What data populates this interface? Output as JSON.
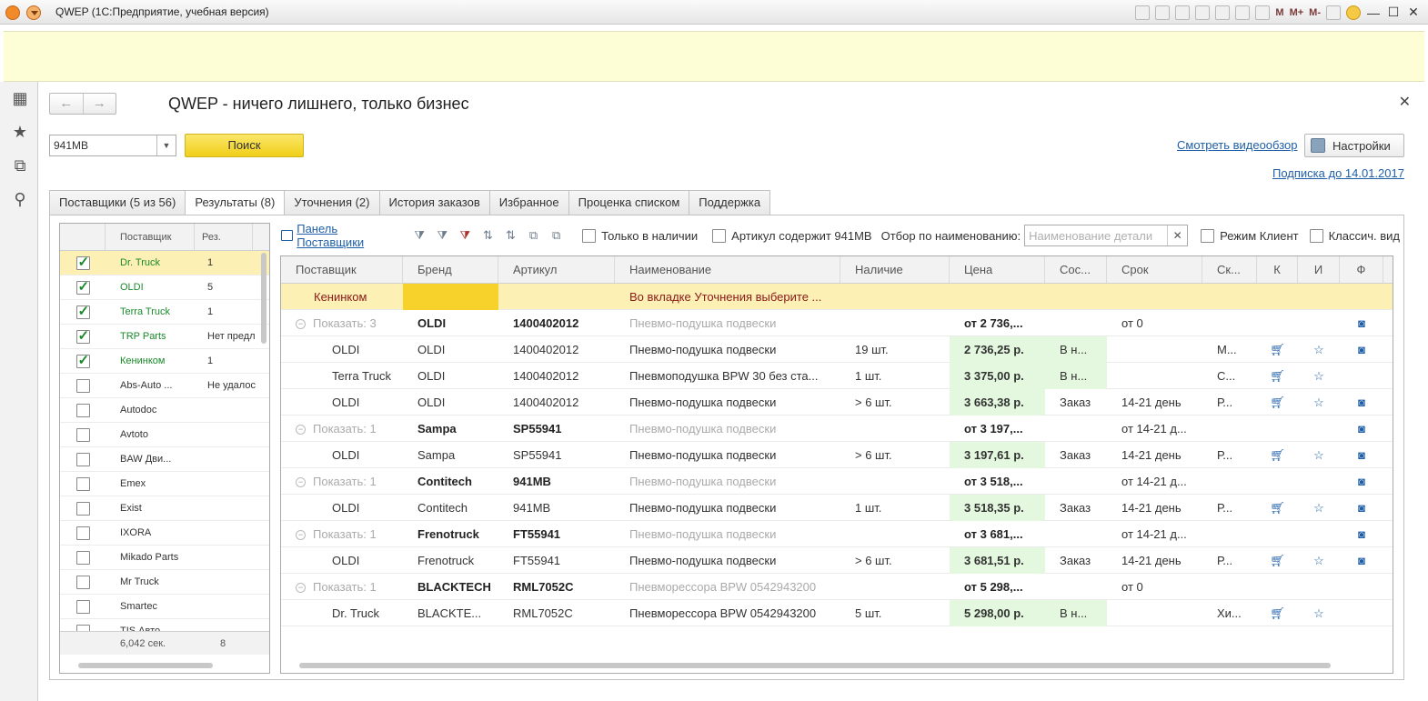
{
  "window": {
    "title": "QWEP  (1С:Предприятие, учебная версия)",
    "toolbar_letters": [
      "M",
      "M+",
      "M-"
    ]
  },
  "form": {
    "title": "QWEP - ничего лишнего, только бизнес",
    "search_value": "941MB",
    "search_button": "Поиск",
    "video_link": "Смотреть видеообзор",
    "settings_button": "Настройки",
    "subscription_link": "Подписка до 14.01.2017"
  },
  "tabs": [
    {
      "label": "Поставщики (5 из 56)"
    },
    {
      "label": "Результаты (8)"
    },
    {
      "label": "Уточнения (2)"
    },
    {
      "label": "История заказов"
    },
    {
      "label": "Избранное"
    },
    {
      "label": "Проценка  списком"
    },
    {
      "label": "Поддержка"
    }
  ],
  "suppliers": {
    "header": {
      "name": "Поставщик",
      "res": "Рез."
    },
    "rows": [
      {
        "name": "Dr. Truck",
        "res": "1",
        "checked": true
      },
      {
        "name": "OLDI",
        "res": "5",
        "checked": true
      },
      {
        "name": "Terra Truck",
        "res": "1",
        "checked": true
      },
      {
        "name": "TRP Parts",
        "res": "Нет предл",
        "checked": true
      },
      {
        "name": "Кенинком",
        "res": "1",
        "checked": true
      },
      {
        "name": "Abs-Auto ...",
        "res": "Не удалос",
        "checked": false
      },
      {
        "name": "Autodoc",
        "res": "",
        "checked": false
      },
      {
        "name": "Avtoto",
        "res": "",
        "checked": false
      },
      {
        "name": "BAW Дви...",
        "res": "",
        "checked": false
      },
      {
        "name": "Emex",
        "res": "",
        "checked": false
      },
      {
        "name": "Exist",
        "res": "",
        "checked": false
      },
      {
        "name": "IXORA",
        "res": "",
        "checked": false
      },
      {
        "name": "Mikado Parts",
        "res": "",
        "checked": false
      },
      {
        "name": "Mr Truck",
        "res": "",
        "checked": false
      },
      {
        "name": "Smartec",
        "res": "",
        "checked": false
      },
      {
        "name": "TIS Авто",
        "res": "",
        "checked": false
      }
    ],
    "footer": {
      "time": "6,042 сек.",
      "total": "8"
    }
  },
  "results_toolbar": {
    "panel_link": "Панель Поставщики",
    "only_in_stock": "Только в наличии",
    "article_contains": "Артикул содержит 941MB",
    "filter_label": "Отбор по наименованию:",
    "filter_placeholder": "Наименование детали",
    "client_mode": "Режим Клиент",
    "classic_view": "Классич. вид"
  },
  "results": {
    "columns": [
      "Поставщик",
      "Бренд",
      "Артикул",
      "Наименование",
      "Наличие",
      "Цена",
      "Сос...",
      "Срок",
      "Ск...",
      "К",
      "И",
      "Ф"
    ],
    "notice": {
      "supplier": "Кенинком",
      "text": "Во вкладке Уточнения выберите ..."
    },
    "rows": [
      {
        "kind": "group",
        "show": "Показать: 3",
        "brand": "OLDI",
        "article": "1400402012",
        "name": "Пневмо-подушка подвески",
        "price": "от 2 736,...",
        "term": "от 0",
        "cam": true
      },
      {
        "kind": "item",
        "supplier": "OLDI",
        "brand": "OLDI",
        "article": "1400402012",
        "name": "Пневмо-подушка подвески",
        "stock": "19 шт.",
        "price": "2 736,25 р.",
        "state": "В н...",
        "term": "",
        "wh": "М...",
        "cam": true
      },
      {
        "kind": "item",
        "supplier": "Terra Truck",
        "brand": "OLDI",
        "article": "1400402012",
        "name": "Пневмоподушка BPW 30 без ста...",
        "stock": "1 шт.",
        "price": "3 375,00 р.",
        "state": "В н...",
        "term": "",
        "wh": "С...",
        "cam": false
      },
      {
        "kind": "item",
        "supplier": "OLDI",
        "brand": "OLDI",
        "article": "1400402012",
        "name": "Пневмо-подушка подвески",
        "stock": "> 6 шт.",
        "price": "3 663,38 р.",
        "state": "Заказ",
        "term": "14-21 день",
        "wh": "Р...",
        "cam": true
      },
      {
        "kind": "group",
        "show": "Показать: 1",
        "brand": "Sampa",
        "article": "SP55941",
        "name": "Пневмо-подушка подвески",
        "price": "от 3 197,...",
        "term": "от 14-21 д...",
        "cam": true
      },
      {
        "kind": "item",
        "supplier": "OLDI",
        "brand": "Sampa",
        "article": "SP55941",
        "name": "Пневмо-подушка подвески",
        "stock": "> 6 шт.",
        "price": "3 197,61 р.",
        "state": "Заказ",
        "term": "14-21 день",
        "wh": "Р...",
        "cam": true
      },
      {
        "kind": "group",
        "show": "Показать: 1",
        "brand": "Contitech",
        "article": "941MB",
        "name": "Пневмо-подушка подвески",
        "price": "от 3 518,...",
        "term": "от 14-21 д...",
        "cam": true
      },
      {
        "kind": "item",
        "supplier": "OLDI",
        "brand": "Contitech",
        "article": "941MB",
        "name": "Пневмо-подушка подвески",
        "stock": "1 шт.",
        "price": "3 518,35 р.",
        "state": "Заказ",
        "term": "14-21 день",
        "wh": "Р...",
        "cam": true
      },
      {
        "kind": "group",
        "show": "Показать: 1",
        "brand": "Frenotruck",
        "article": "FT55941",
        "name": "Пневмо-подушка подвески",
        "price": "от 3 681,...",
        "term": "от 14-21 д...",
        "cam": true
      },
      {
        "kind": "item",
        "supplier": "OLDI",
        "brand": "Frenotruck",
        "article": "FT55941",
        "name": "Пневмо-подушка подвески",
        "stock": "> 6 шт.",
        "price": "3 681,51 р.",
        "state": "Заказ",
        "term": "14-21 день",
        "wh": "Р...",
        "cam": true
      },
      {
        "kind": "group",
        "show": "Показать: 1",
        "brand": "BLACKTECH",
        "article": "RML7052C",
        "name": "Пневморессора BPW 0542943200",
        "price": "от 5 298,...",
        "term": "от 0",
        "cam": false
      },
      {
        "kind": "item",
        "supplier": "Dr. Truck",
        "brand": "BLACKTE...",
        "article": "RML7052C",
        "name": "Пневморессора BPW 0542943200",
        "stock": "5 шт.",
        "price": "5 298,00 р.",
        "state": "В н...",
        "term": "",
        "wh": "Хи...",
        "cam": false
      }
    ]
  },
  "colors": {
    "accent": "#f0cf18",
    "link": "#1f5fa8",
    "ok": "#1a8a2a",
    "price_bg": "#e3f8de",
    "selection": "#fcf0b4"
  }
}
